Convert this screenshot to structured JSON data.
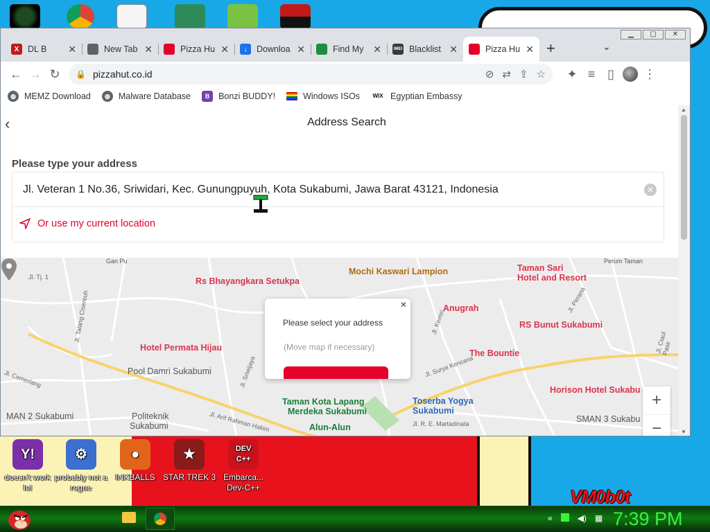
{
  "browser": {
    "tabs": [
      {
        "title": "DL B",
        "fav_color": "#c21a1a",
        "fav_text": "X"
      },
      {
        "title": "New Tab",
        "fav_color": "#5f6368",
        "fav_text": ""
      },
      {
        "title": "Pizza Hu",
        "fav_color": "#e4002b",
        "fav_text": ""
      },
      {
        "title": "Downloa",
        "fav_color": "#1a73e8",
        "fav_text": "↓"
      },
      {
        "title": "Find My",
        "fav_color": "#1e8e3e",
        "fav_text": ""
      },
      {
        "title": "Blacklist",
        "fav_color": "#3a3a3a",
        "fav_text": "IMEI"
      },
      {
        "title": "Pizza Hu",
        "fav_color": "#e4002b",
        "fav_text": ""
      }
    ],
    "url": "pizzahut.co.id",
    "bookmarks": [
      {
        "label": "MEMZ Download",
        "icon": "globe-icon"
      },
      {
        "label": "Malware Database",
        "icon": "globe-icon"
      },
      {
        "label": "Bonzi BUDDY!",
        "icon": "bonzi-icon"
      },
      {
        "label": "Windows ISOs",
        "icon": "rainbow-flag-icon"
      },
      {
        "label": "Egyptian Embassy",
        "icon": "wix-icon"
      }
    ]
  },
  "page": {
    "title": "Address Search",
    "field_label": "Please type your address",
    "address_value": "Jl. Veteran 1 No.36, Sriwidari, Kec. Gunungpuyuh, Kota Sukabumi, Jawa Barat 43121, Indonesia",
    "current_location": "Or use my current location"
  },
  "map": {
    "pois": [
      {
        "label": "Mochi Kaswari Lampion",
        "cls": "brown"
      },
      {
        "label": "Taman Sari",
        "cls": "red"
      },
      {
        "label": "Hotel and Resort",
        "cls": "red"
      },
      {
        "label": "Rs Bhayangkara Setukpa",
        "cls": "red"
      },
      {
        "label": "Anugrah",
        "cls": "red"
      },
      {
        "label": "RS Bunut Sukabumi",
        "cls": "red"
      },
      {
        "label": "Hotel Permata Hijau",
        "cls": "red"
      },
      {
        "label": "The Bountie",
        "cls": "red"
      },
      {
        "label": "Pool Damri Sukabumi",
        "cls": "gray"
      },
      {
        "label": "Horison Hotel Sukabu",
        "cls": "red"
      },
      {
        "label": "Taman Kota Lapang",
        "cls": "green"
      },
      {
        "label": "Merdeka Sukabumi",
        "cls": "green"
      },
      {
        "label": "Toserba Yogya",
        "cls": "blue"
      },
      {
        "label": "Sukabumi",
        "cls": "blue"
      },
      {
        "label": "Politeknik",
        "cls": "gray"
      },
      {
        "label": "Sukabumi",
        "cls": "gray"
      },
      {
        "label": "MAN 2 Sukabumi",
        "cls": "gray"
      },
      {
        "label": "SMAN 3 Sukabu",
        "cls": "gray"
      },
      {
        "label": "Alun-Alun",
        "cls": "green"
      },
      {
        "label": "Perum Taman",
        "cls": "gray"
      },
      {
        "label": "Gan Pu",
        "cls": "gray"
      }
    ],
    "roads": [
      "Jl. Tj. 1",
      "Jl. Talang Cisereuh",
      "Jl. Cemerlang",
      "Jl. Sriwijaya",
      "Jl. Arif Rahman Hakim",
      "Jl. Surya Kencana",
      "Jl. R. E. Martadinata",
      "Jl. Kemiri",
      "Jl. Perana",
      "Jl. Ciaul Pasir"
    ],
    "popup": {
      "line1": "Please select your address",
      "line2": "(Move map if necessary)"
    },
    "zoom_in": "+",
    "zoom_out": "−"
  },
  "desktop": {
    "icons": [
      {
        "label": "doesn't work lol",
        "color": "#7b2fa8",
        "glyph": "Y!"
      },
      {
        "label": "probably not a rogue",
        "color": "#3b6fd0",
        "glyph": "⚙"
      },
      {
        "label": "INKBALLS",
        "color": "#e0651a",
        "glyph": "●"
      },
      {
        "label": "STAR TREK 3",
        "color": "#8b1a1a",
        "glyph": "★"
      },
      {
        "label": "Embarca... Dev-C++",
        "color": "#c9121c",
        "glyph": "DEV C++"
      }
    ],
    "graffiti": "VM0b0t"
  },
  "taskbar": {
    "clock": "7:39 PM"
  }
}
